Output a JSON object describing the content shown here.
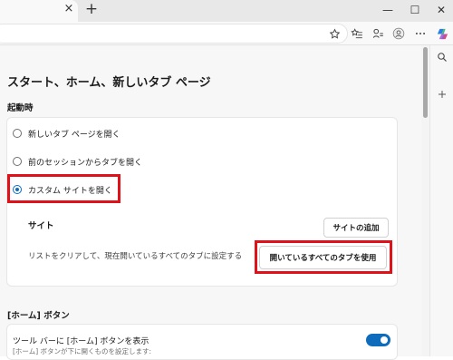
{
  "browser": {
    "tab_close_glyph": "×",
    "new_tab_glyph": "+",
    "window_controls": {
      "minimize": "—",
      "maximize": "☐",
      "close": "✕"
    },
    "toolbar_icons": [
      "star-icon",
      "favorites-icon",
      "collections-icon",
      "profile-icon",
      "more-icon",
      "copilot-icon"
    ],
    "sidebar_icons": [
      "search-icon",
      "add-icon"
    ]
  },
  "page": {
    "title": "スタート、ホーム、新しいタブ ページ",
    "startup": {
      "section_label": "起動時",
      "options": [
        {
          "label": "新しいタブ ページを開く",
          "checked": false
        },
        {
          "label": "前のセッションからタブを開く",
          "checked": false
        },
        {
          "label": "カスタム サイトを開く",
          "checked": true
        }
      ],
      "sites": {
        "label": "サイト",
        "add_button": "サイトの追加",
        "description": "リストをクリアして、現在開いているすべてのタブに設定する",
        "use_all_tabs_button": "開いているすべてのタブを使用"
      }
    },
    "home_button": {
      "section_label": "[ホーム] ボタン",
      "toggle_label": "ツール バーに [ホーム] ボタンを表示",
      "toggle_on": true,
      "sub_text": "[ホーム] ボタンが下に開くものを設定します:"
    }
  },
  "colors": {
    "accent": "#0f6cbd",
    "highlight": "#e1111a"
  }
}
